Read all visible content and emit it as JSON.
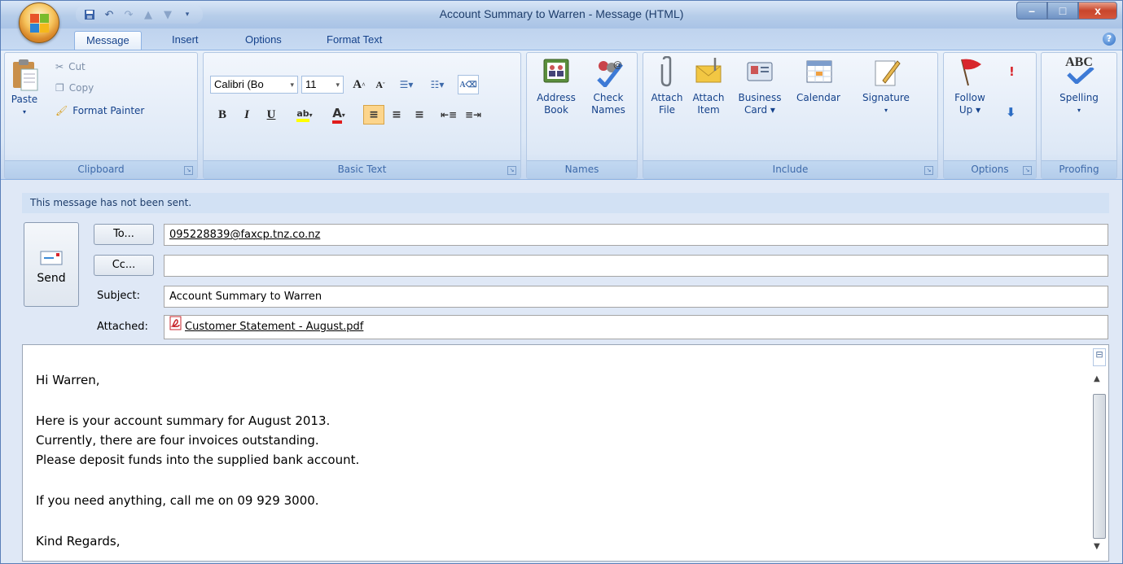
{
  "window": {
    "title": "Account Summary to Warren  -  Message (HTML)",
    "controls": {
      "minimize": "–",
      "maximize": "□",
      "close": "x"
    }
  },
  "quick_access": [
    {
      "icon": "save-icon"
    },
    {
      "icon": "undo-icon"
    },
    {
      "icon": "redo-icon"
    },
    {
      "icon": "up-arrow-icon"
    },
    {
      "icon": "down-arrow-icon"
    },
    {
      "icon": "customize-dropdown-icon"
    }
  ],
  "tabs": [
    "Message",
    "Insert",
    "Options",
    "Format Text"
  ],
  "ribbon": {
    "clipboard": {
      "label": "Clipboard",
      "paste": "Paste",
      "cut": "Cut",
      "copy": "Copy",
      "format_painter": "Format Painter"
    },
    "basic_text": {
      "label": "Basic Text",
      "font": "Calibri (Bo",
      "size": "11",
      "bold": "B",
      "italic": "I",
      "underline": "U",
      "highlight": "ab",
      "font_color": "A"
    },
    "names": {
      "label": "Names",
      "address_book_1": "Address",
      "address_book_2": "Book",
      "check_names_1": "Check",
      "check_names_2": "Names"
    },
    "include": {
      "label": "Include",
      "attach_file_1": "Attach",
      "attach_file_2": "File",
      "attach_item_1": "Attach",
      "attach_item_2": "Item",
      "business_card_1": "Business",
      "business_card_2": "Card ▾",
      "calendar": "Calendar",
      "signature": "Signature"
    },
    "options": {
      "label": "Options",
      "follow_up_1": "Follow",
      "follow_up_2": "Up ▾"
    },
    "proofing": {
      "label": "Proofing",
      "spelling": "Spelling",
      "abc": "ABC"
    }
  },
  "notice": "This message has not been sent.",
  "header": {
    "send": "Send",
    "to_button": "To...",
    "cc_button": "Cc...",
    "to_value": "095228839@faxcp.tnz.co.nz",
    "cc_value": "",
    "subject_label": "Subject:",
    "subject_value": "Account Summary to Warren",
    "attached_label": "Attached:",
    "attachment": "Customer Statement - August.pdf"
  },
  "body": {
    "line1": "Hi Warren,",
    "line2": "Here is your account summary for August 2013.",
    "line3": "Currently, there are four invoices outstanding.",
    "line4": "Please deposit funds into the supplied bank account.",
    "line5": "If you need anything, call me on 09 929 3000.",
    "line6": "Kind Regards,"
  },
  "colors": {
    "ribbon_text": "#15428b",
    "highlight_yellow": "#ffff00",
    "font_red": "#e01c1c",
    "title_bar": "#b6cde9"
  }
}
